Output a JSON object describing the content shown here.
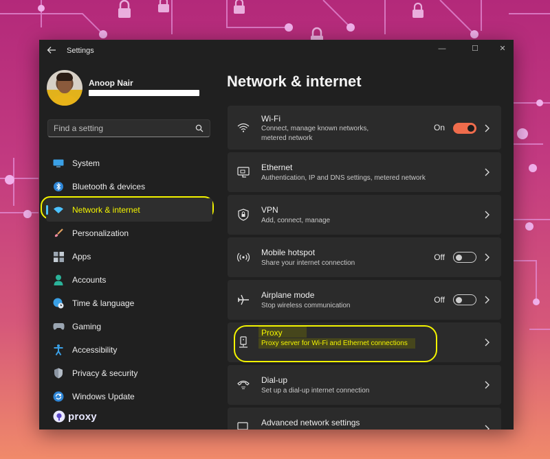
{
  "window": {
    "app_title": "Settings",
    "controls": {
      "minimize": "—",
      "maximize": "☐",
      "close": "✕"
    }
  },
  "profile": {
    "name": "Anoop Nair"
  },
  "search": {
    "placeholder": "Find a setting"
  },
  "sidebar": {
    "items": [
      {
        "label": "System",
        "icon": "monitor-icon"
      },
      {
        "label": "Bluetooth & devices",
        "icon": "bluetooth-icon"
      },
      {
        "label": "Network & internet",
        "icon": "wifi-icon",
        "active": true
      },
      {
        "label": "Personalization",
        "icon": "brush-icon"
      },
      {
        "label": "Apps",
        "icon": "apps-icon"
      },
      {
        "label": "Accounts",
        "icon": "person-icon"
      },
      {
        "label": "Time & language",
        "icon": "globe-clock-icon"
      },
      {
        "label": "Gaming",
        "icon": "gamepad-icon"
      },
      {
        "label": "Accessibility",
        "icon": "accessibility-icon"
      },
      {
        "label": "Privacy & security",
        "icon": "shield-icon"
      },
      {
        "label": "Windows Update",
        "icon": "update-icon"
      }
    ]
  },
  "watermark": {
    "text": "proxy"
  },
  "main": {
    "title": "Network & internet",
    "cards": [
      {
        "title": "Wi-Fi",
        "desc_line1": "Connect, manage known networks,",
        "desc_line2": "metered network",
        "state": "On",
        "toggle": "on",
        "icon": "wifi-icon"
      },
      {
        "title": "Ethernet",
        "desc_line1": "Authentication, IP and DNS settings, metered network",
        "icon": "ethernet-icon"
      },
      {
        "title": "VPN",
        "desc_line1": "Add, connect, manage",
        "icon": "vpn-shield-icon"
      },
      {
        "title": "Mobile hotspot",
        "desc_line1": "Share your internet connection",
        "state": "Off",
        "toggle": "off",
        "icon": "hotspot-icon"
      },
      {
        "title": "Airplane mode",
        "desc_line1": "Stop wireless communication",
        "state": "Off",
        "toggle": "off",
        "icon": "airplane-icon"
      },
      {
        "title": "Proxy",
        "desc_line1": "Proxy server for Wi-Fi and Ethernet connections",
        "icon": "proxy-icon"
      },
      {
        "title": "Dial-up",
        "desc_line1": "Set up a dial-up internet connection",
        "icon": "dialup-icon"
      },
      {
        "title": "Advanced network settings",
        "desc_line1": "",
        "icon": "advanced-network-icon"
      }
    ]
  },
  "colors": {
    "accent": "#4cc2ff",
    "toggle_on": "#ef6c4c",
    "highlight": "#f4f500",
    "window_bg": "#202020",
    "card_bg": "#2b2b2b"
  }
}
